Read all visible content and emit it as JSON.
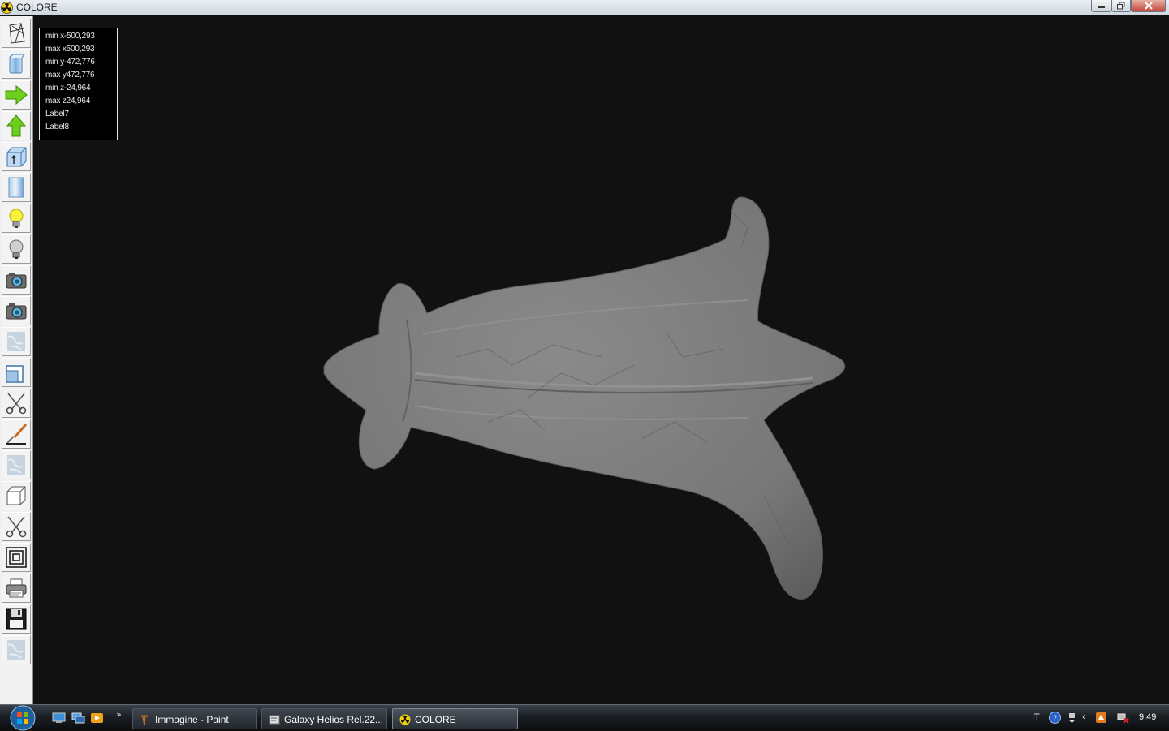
{
  "window": {
    "title": "COLORE"
  },
  "info": {
    "lines": [
      "min x-500,293",
      "max x500,293",
      "min y-472,776",
      "max y472,776",
      "min z-24,964",
      "max z24,964",
      "Label7",
      "Label8"
    ]
  },
  "toolbar": {
    "tools": [
      "wireframe-icon",
      "solid-view-icon",
      "right-arrow-icon",
      "up-arrow-icon",
      "box-info-icon",
      "cylinder-icon",
      "light-on-icon",
      "light-off-icon",
      "camera-icon",
      "camera-2-icon",
      "marble-texture-icon",
      "resize-icon",
      "scissors-icon",
      "brush-icon",
      "marble-texture-2-icon",
      "cube-icon",
      "scissors-2-icon",
      "concentric-squares-icon",
      "printer-icon",
      "floppy-save-icon",
      "marble-texture-3-icon"
    ]
  },
  "taskbar": {
    "tasks": [
      {
        "label": "Immagine - Paint"
      },
      {
        "label": "Galaxy Helios  Rel.22..."
      },
      {
        "label": "COLORE"
      }
    ],
    "language": "IT",
    "clock": "9.49"
  },
  "colors": {
    "viewport_bg": "#111111",
    "model_gray": "#7c7c7c",
    "taskbar": "#1b1f24"
  }
}
